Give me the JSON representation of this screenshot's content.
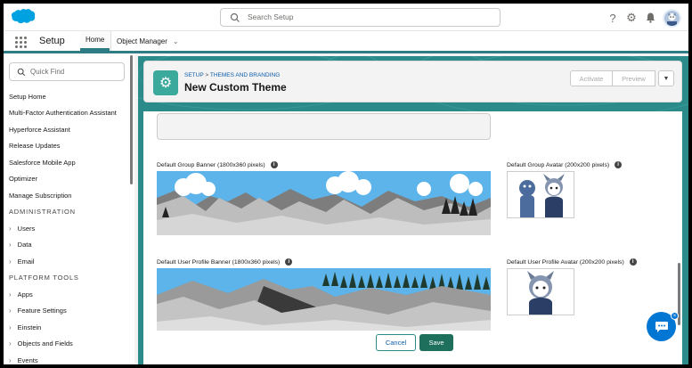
{
  "header": {
    "search_placeholder": "Search Setup",
    "icons": [
      "help-icon",
      "gear-icon",
      "bell-icon",
      "avatar"
    ]
  },
  "nav": {
    "app_name": "Setup",
    "tabs": [
      {
        "label": "Home",
        "active": true
      },
      {
        "label": "Object Manager",
        "active": false
      }
    ]
  },
  "sidebar": {
    "quick_find_placeholder": "Quick Find",
    "items": [
      "Setup Home",
      "Multi-Factor Authentication Assistant",
      "Hyperforce Assistant",
      "Release Updates",
      "Salesforce Mobile App",
      "Optimizer",
      "Manage Subscription"
    ],
    "section_admin": "ADMINISTRATION",
    "admin_items": [
      "Users",
      "Data",
      "Email"
    ],
    "section_platform": "PLATFORM TOOLS",
    "platform_items": [
      "Apps",
      "Feature Settings",
      "Einstein",
      "Objects and Fields",
      "Events"
    ]
  },
  "page": {
    "breadcrumb_1": "SETUP",
    "breadcrumb_sep": ">",
    "breadcrumb_2": "THEMES AND BRANDING",
    "title": "New Custom Theme",
    "activate_label": "Activate",
    "preview_label": "Preview"
  },
  "content": {
    "group_banner_label": "Default Group Banner (1800x360 pixels)",
    "group_avatar_label": "Default Group Avatar (200x200 pixels)",
    "profile_banner_label": "Default User Profile Banner (1800x360 pixels)",
    "profile_avatar_label": "Default User Profile Avatar (200x200 pixels)"
  },
  "footer": {
    "cancel_label": "Cancel",
    "save_label": "Save"
  },
  "colors": {
    "brand_teal": "#2b8a8a",
    "save_green": "#1e6f5c",
    "link_blue": "#0b5cab",
    "chat_blue": "#0176d3"
  }
}
